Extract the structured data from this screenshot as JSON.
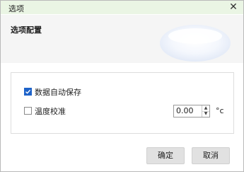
{
  "dialog": {
    "title": "选项",
    "close_glyph": "✕"
  },
  "header": {
    "title": "选项配置"
  },
  "options": {
    "auto_save": {
      "label": "数据自动保存",
      "checked": true
    },
    "temp_calibration": {
      "label": "温度校准",
      "checked": false,
      "value": "0.00",
      "unit": "°c"
    }
  },
  "buttons": {
    "ok": "确定",
    "cancel": "取消"
  },
  "colors": {
    "titlebar_bg": "#eaf5e4",
    "checkbox_checked": "#1e63c9",
    "header_bg": "#f5f5f5"
  }
}
